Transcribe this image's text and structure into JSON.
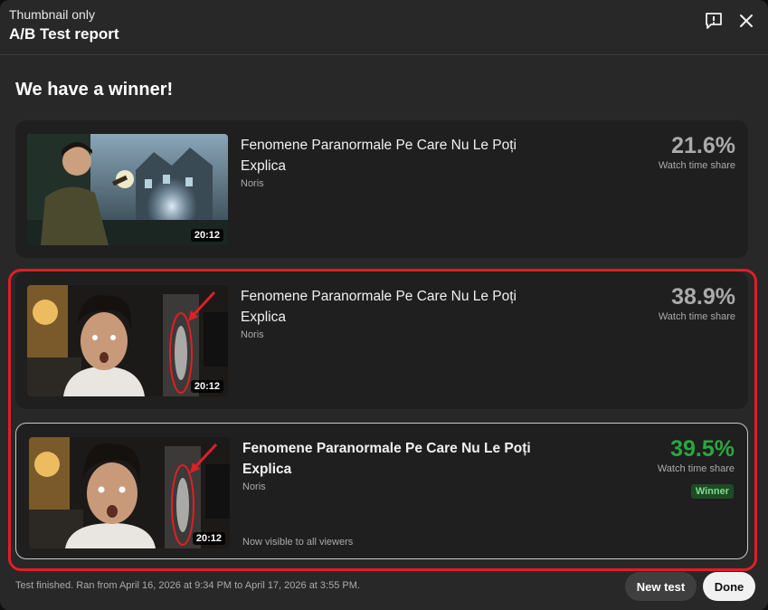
{
  "header": {
    "subtitle": "Thumbnail only",
    "title": "A/B Test report",
    "feedback_icon": "feedback-icon",
    "close_icon": "close-icon"
  },
  "headline": "We have a winner!",
  "variants": [
    {
      "title": "Fenomene Paranormale Pe Care Nu Le Poți Explica",
      "channel": "Noris",
      "duration": "20:12",
      "share": "21.6%",
      "share_label": "Watch time share"
    },
    {
      "title": "Fenomene Paranormale Pe Care Nu Le Poți Explica",
      "channel": "Noris",
      "duration": "20:12",
      "share": "38.9%",
      "share_label": "Watch time share"
    },
    {
      "title": "Fenomene Paranormale Pe Care Nu Le Poți Explica",
      "channel": "Noris",
      "duration": "20:12",
      "share": "39.5%",
      "share_label": "Watch time share",
      "badge": "Winner",
      "note": "Now visible to all viewers"
    }
  ],
  "footer": {
    "status": "Test finished. Ran from April 16, 2026 at 9:34 PM to April 17, 2026 at 3:55 PM.",
    "new_test_label": "New test",
    "done_label": "Done"
  },
  "colors": {
    "winner_green": "#2ba640",
    "highlight_red": "#e01e25",
    "background": "#282828"
  }
}
